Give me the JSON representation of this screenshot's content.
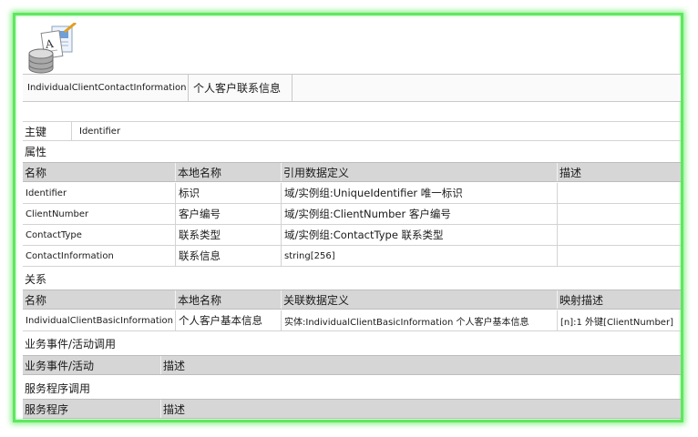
{
  "entity": {
    "name": "IndividualClientContactInformation",
    "local_name": "个人客户联系信息",
    "icon": "database-document-icon"
  },
  "primary_key": {
    "label": "主键",
    "value": "Identifier"
  },
  "attributes": {
    "section_title": "属性",
    "headers": [
      "名称",
      "本地名称",
      "引用数据定义",
      "描述"
    ],
    "rows": [
      {
        "name": "Identifier",
        "local": "标识",
        "ref": "域/实例组:UniqueIdentifier 唯一标识",
        "desc": ""
      },
      {
        "name": "ClientNumber",
        "local": "客户编号",
        "ref": "域/实例组:ClientNumber 客户编号",
        "desc": ""
      },
      {
        "name": "ContactType",
        "local": "联系类型",
        "ref": "域/实例组:ContactType 联系类型",
        "desc": ""
      },
      {
        "name": "ContactInformation",
        "local": "联系信息",
        "ref": "string[256]",
        "desc": ""
      }
    ]
  },
  "relations": {
    "section_title": "关系",
    "headers": [
      "名称",
      "本地名称",
      "关联数据定义",
      "映射描述"
    ],
    "rows": [
      {
        "name": "IndividualClientBasicInformation",
        "local": "个人客户基本信息",
        "ref": "实体:IndividualClientBasicInformation 个人客户基本信息",
        "desc": "[n]:1 外键[ClientNumber]"
      }
    ]
  },
  "events": {
    "section_title": "业务事件/活动调用",
    "headers": [
      "业务事件/活动",
      "描述"
    ]
  },
  "services": {
    "section_title": "服务程序调用",
    "headers": [
      "服务程序",
      "描述"
    ]
  }
}
